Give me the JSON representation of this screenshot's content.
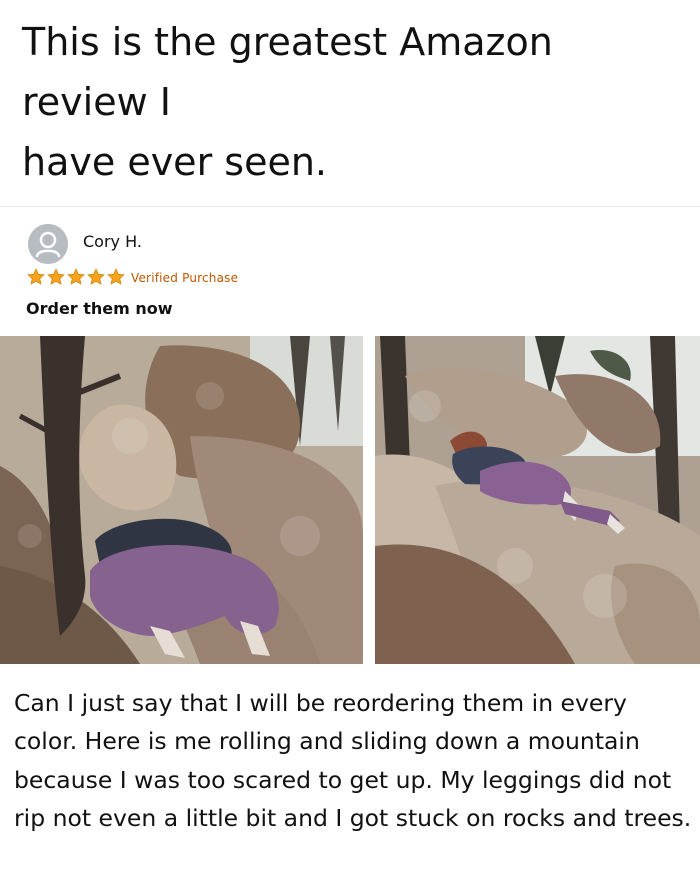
{
  "header": {
    "title_lines": [
      "This is the greatest Amazon",
      "review I",
      "have ever seen."
    ]
  },
  "review": {
    "reviewer_name": "Cory H.",
    "rating": 5,
    "rating_max": 5,
    "verified_label": "Verified Purchase",
    "title": "Order them now",
    "body": "Can I just say that I will be reordering them in every color. Here is me rolling and sliding down a mountain because I was too scared to get up. My leggings did not rip not even a little bit and I got stuck on rocks and trees.",
    "icons": {
      "avatar": "user-avatar-icon",
      "star": "star-icon"
    },
    "colors": {
      "star": "#f7a21b",
      "verified": "#c45500",
      "avatar": "#b7bcc2"
    }
  }
}
